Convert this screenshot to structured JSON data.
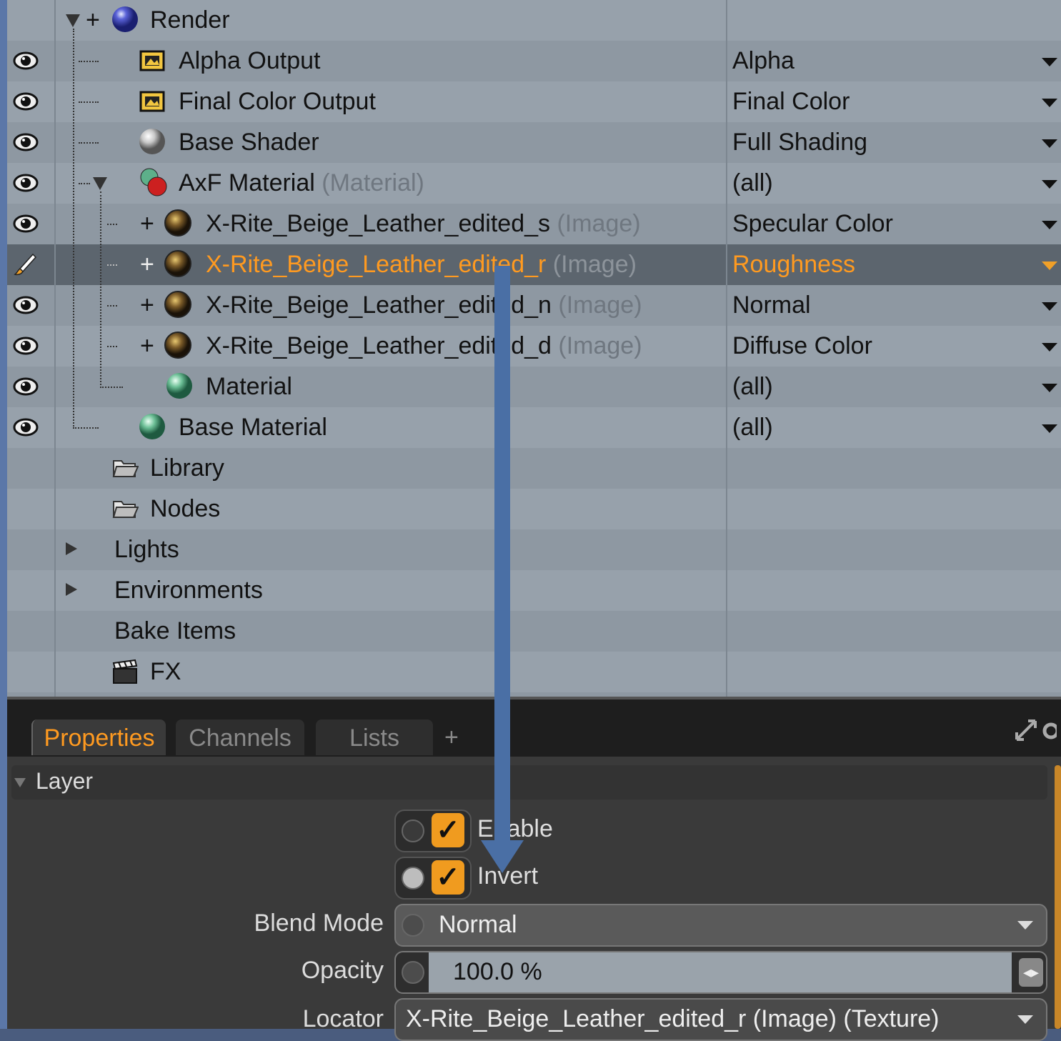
{
  "tree": {
    "rows": [
      {
        "label": "Render",
        "note": "",
        "value": ""
      },
      {
        "label": "Alpha Output",
        "note": "",
        "value": "Alpha"
      },
      {
        "label": "Final Color Output",
        "note": "",
        "value": "Final Color"
      },
      {
        "label": "Base Shader",
        "note": "",
        "value": "Full Shading"
      },
      {
        "label": "AxF Material",
        "note": "(Material)",
        "value": "(all)"
      },
      {
        "label": "X-Rite_Beige_Leather_edited_s",
        "note": "(Image)",
        "value": "Specular Color"
      },
      {
        "label": "X-Rite_Beige_Leather_edited_r",
        "note": "(Image)",
        "value": "Roughness"
      },
      {
        "label": "X-Rite_Beige_Leather_edited_n",
        "note": "(Image)",
        "value": "Normal"
      },
      {
        "label": "X-Rite_Beige_Leather_edited_d",
        "note": "(Image)",
        "value": "Diffuse Color"
      },
      {
        "label": "Material",
        "note": "",
        "value": "(all)"
      },
      {
        "label": "Base Material",
        "note": "",
        "value": "(all)"
      },
      {
        "label": "Library",
        "note": "",
        "value": ""
      },
      {
        "label": "Nodes",
        "note": "",
        "value": ""
      },
      {
        "label": "Lights",
        "note": "",
        "value": ""
      },
      {
        "label": "Environments",
        "note": "",
        "value": ""
      },
      {
        "label": "Bake Items",
        "note": "",
        "value": ""
      },
      {
        "label": "FX",
        "note": "",
        "value": ""
      }
    ]
  },
  "tabs": {
    "properties": "Properties",
    "channels": "Channels",
    "lists": "Lists",
    "add": "+"
  },
  "properties": {
    "section": "Layer",
    "enable_label": "Enable",
    "invert_label": "Invert",
    "blend_mode_label": "Blend Mode",
    "blend_mode_value": "Normal",
    "opacity_label": "Opacity",
    "opacity_value": "100.0 %",
    "locator_label": "Locator",
    "locator_value": "X-Rite_Beige_Leather_edited_r (Image) (Texture)"
  },
  "colors": {
    "accent": "#ff9a20",
    "annotation_arrow": "#4a6fa5"
  }
}
